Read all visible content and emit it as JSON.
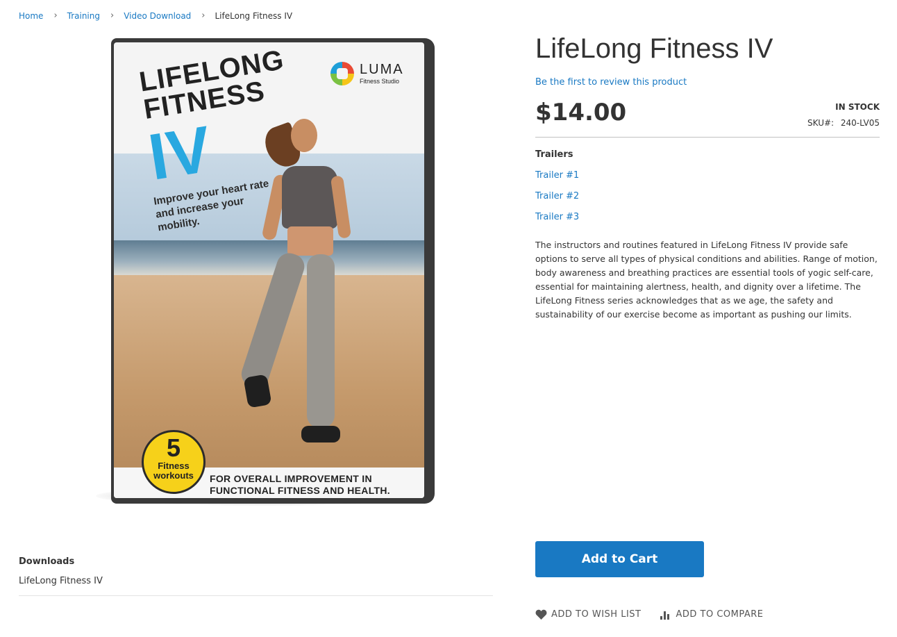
{
  "breadcrumbs": {
    "items": [
      "Home",
      "Training",
      "Video Download"
    ],
    "current": "LifeLong Fitness IV",
    "separator": "›"
  },
  "cover": {
    "title_line1": "LIFELONG",
    "title_line2": "FITNESS",
    "title_iv": "IV",
    "tagline": "Improve your heart rate and increase your mobility.",
    "brand_name": "LUMA",
    "brand_sub": "Fitness Studio",
    "badge_number": "5",
    "badge_label_line1": "Fitness",
    "badge_label_line2": "workouts",
    "footer_line1": "FOR OVERALL IMPROVEMENT IN",
    "footer_line2": "FUNCTIONAL FITNESS AND HEALTH."
  },
  "product": {
    "title": "LifeLong Fitness IV",
    "review_link": "Be the first to review this product",
    "price": "$14.00",
    "stock": "IN STOCK",
    "sku_label": "SKU#:",
    "sku": "240-LV05",
    "trailers_heading": "Trailers",
    "trailers": [
      "Trailer #1",
      "Trailer #2",
      "Trailer #3"
    ],
    "description": "The instructors and routines featured in LifeLong Fitness IV provide safe options to serve all types of physical conditions and abilities. Range of motion, body awareness and breathing practices are essential tools of yogic self-care, essential for maintaining alertness, health, and dignity over a lifetime. The LifeLong Fitness series acknowledges that as we age, the safety and sustainability of our exercise become as important as pushing our limits."
  },
  "actions": {
    "add_to_cart": "Add to Cart",
    "wishlist": "ADD TO WISH LIST",
    "compare": "ADD TO COMPARE",
    "wishlist_icon": "heart-icon",
    "compare_icon": "bar-chart-icon"
  },
  "downloads": {
    "heading": "Downloads",
    "items": [
      "LifeLong Fitness IV"
    ]
  },
  "colors": {
    "link": "#1979c3",
    "primary_button": "#1979c3",
    "cover_accent": "#29a8e0",
    "badge": "#f6d11a"
  }
}
